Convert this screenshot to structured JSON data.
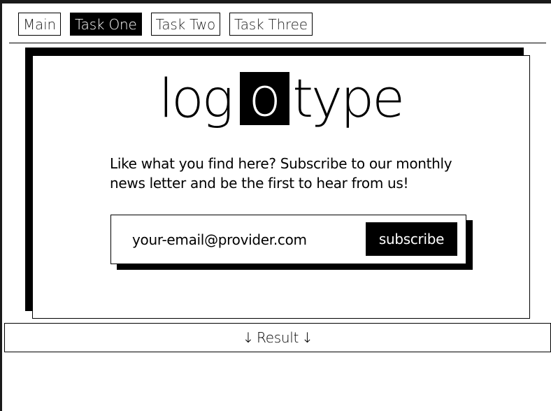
{
  "nav": {
    "tabs": [
      {
        "label": "Main",
        "active": false
      },
      {
        "label": "Task One",
        "active": true
      },
      {
        "label": "Task Two",
        "active": false
      },
      {
        "label": "Task Three",
        "active": false
      }
    ]
  },
  "logo": {
    "prefix": "log",
    "boxed_letter": "o",
    "suffix": "type"
  },
  "tagline": "Like what you find here? Subscribe to our monthly news letter and be the first to hear from us!",
  "subscribe_form": {
    "email_placeholder": "your-email@provider.com",
    "button_label": "subscribe"
  },
  "result": {
    "arrow_left": "↓",
    "label": "Result",
    "arrow_right": "↓"
  },
  "colors": {
    "accent": "#000000",
    "background": "#ffffff"
  }
}
